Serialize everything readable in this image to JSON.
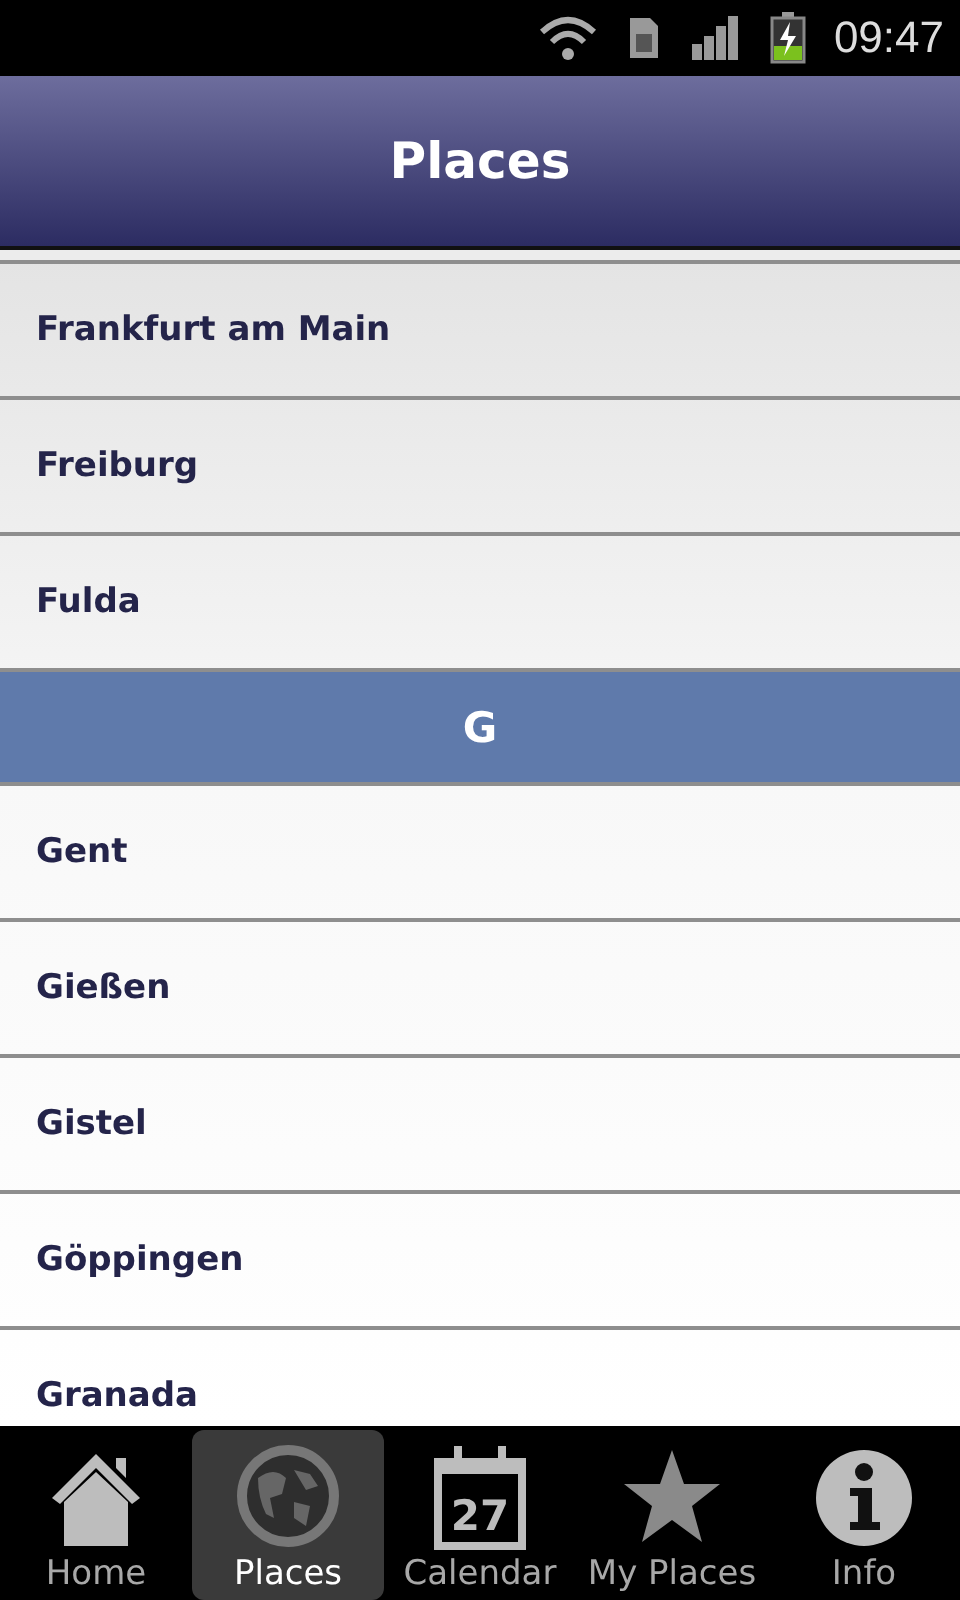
{
  "status_bar": {
    "time": "09:47"
  },
  "header": {
    "title": "Places"
  },
  "list": [
    {
      "kind": "item",
      "label": "Frankfurt am Main"
    },
    {
      "kind": "item",
      "label": "Freiburg"
    },
    {
      "kind": "item",
      "label": "Fulda"
    },
    {
      "kind": "section",
      "label": "G"
    },
    {
      "kind": "item",
      "label": "Gent"
    },
    {
      "kind": "item",
      "label": "Gießen"
    },
    {
      "kind": "item",
      "label": "Gistel"
    },
    {
      "kind": "item",
      "label": "Göppingen"
    },
    {
      "kind": "item",
      "label": "Granada"
    }
  ],
  "tabs": [
    {
      "kind": "home",
      "label": "Home",
      "selected": false
    },
    {
      "kind": "globe",
      "label": "Places",
      "selected": true
    },
    {
      "kind": "calendar",
      "label": "Calendar",
      "selected": false,
      "icon_text": "27"
    },
    {
      "kind": "star",
      "label": "My Places",
      "selected": false
    },
    {
      "kind": "info",
      "label": "Info",
      "selected": false
    }
  ]
}
